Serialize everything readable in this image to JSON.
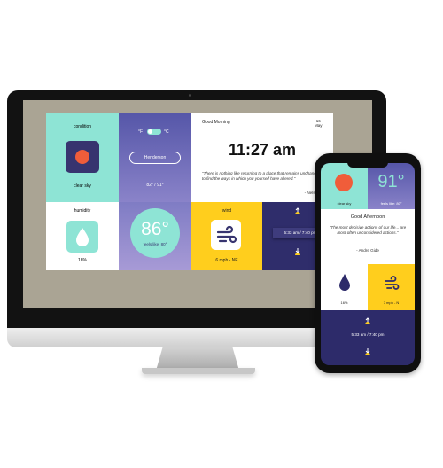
{
  "desktop": {
    "condition": {
      "label": "condition",
      "value": "clear sky",
      "icon": "sun-icon"
    },
    "humidity": {
      "label": "humidity",
      "value": "18%",
      "icon": "droplet-icon"
    },
    "units": {
      "fahrenheit": "°F",
      "celsius": "°C"
    },
    "location": {
      "city": "Henderson",
      "range": "82° / 91°"
    },
    "temperature": {
      "value": "86°",
      "feels_like": "feels like: 80°"
    },
    "greeting": {
      "title": "Good Morning",
      "date_day": "16",
      "date_month": "May",
      "time": "11:27 am",
      "quote": "\"There is nothing like returning to a place that remains unchanged to find the ways in which you yourself have altered.\"",
      "author": "- Nelson Mande"
    },
    "wind": {
      "label": "wind",
      "value": "6 mph - NE",
      "icon": "wind-icon"
    },
    "sun": {
      "times": "5:33 am / 7:40 pm",
      "icon": "sunrise-sunset-icon"
    },
    "colors": {
      "mint": "#8ee4d5",
      "indigo": "#37346f",
      "yellow": "#ffce1d",
      "sun": "#f05d3a"
    }
  },
  "phone": {
    "condition": {
      "value": "clear sky"
    },
    "temperature": {
      "value": "91°",
      "feels_like": "feels like: 80°"
    },
    "greeting": {
      "title": "Good Afternoon",
      "quote": "\"The most decisive actions of our life... are most often unconsidered actions.\"",
      "author": "- Andre Gide"
    },
    "humidity": {
      "value": "16%"
    },
    "wind": {
      "value": "7 mph - N"
    },
    "sun": {
      "times": "5:33 am / 7:40 pm"
    }
  }
}
